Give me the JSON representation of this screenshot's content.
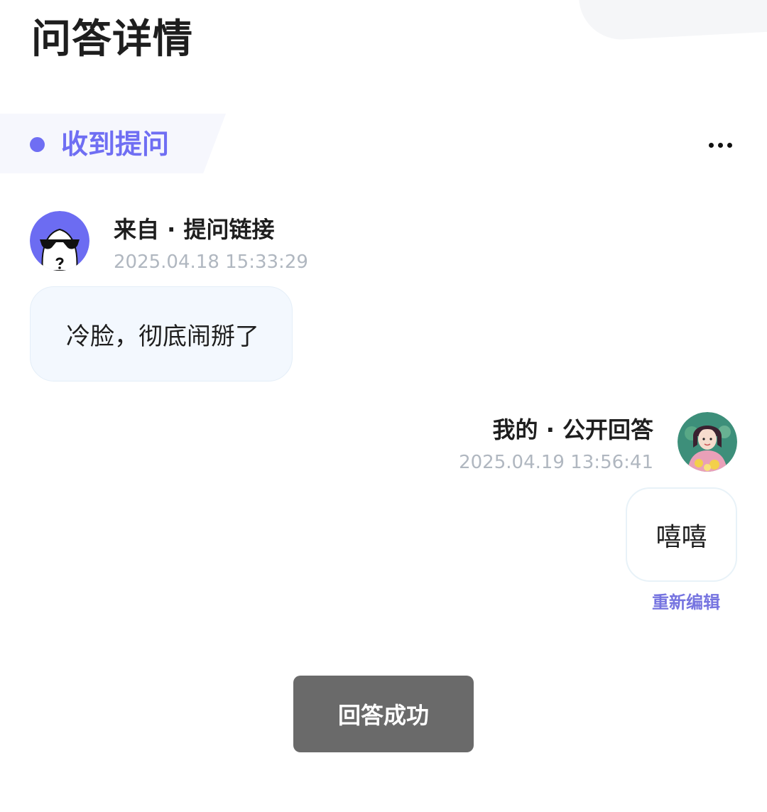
{
  "page": {
    "title": "问答详情"
  },
  "section": {
    "label": "收到提问",
    "accent_color": "#6f6ef3",
    "more_icon": "more-horizontal-icon"
  },
  "question": {
    "source": "来自 · 提问链接",
    "time": "2025.04.18 15:33:29",
    "content": "冷脸，彻底闹掰了",
    "avatar": "anonymous-sunglasses-avatar"
  },
  "answer": {
    "source": "我的 · 公开回答",
    "time": "2025.04.19 13:56:41",
    "content": "嘻嘻",
    "avatar": "user-photo-avatar",
    "re_edit_label": "重新编辑",
    "link_color": "#7674e0"
  },
  "toast": {
    "message": "回答成功"
  }
}
